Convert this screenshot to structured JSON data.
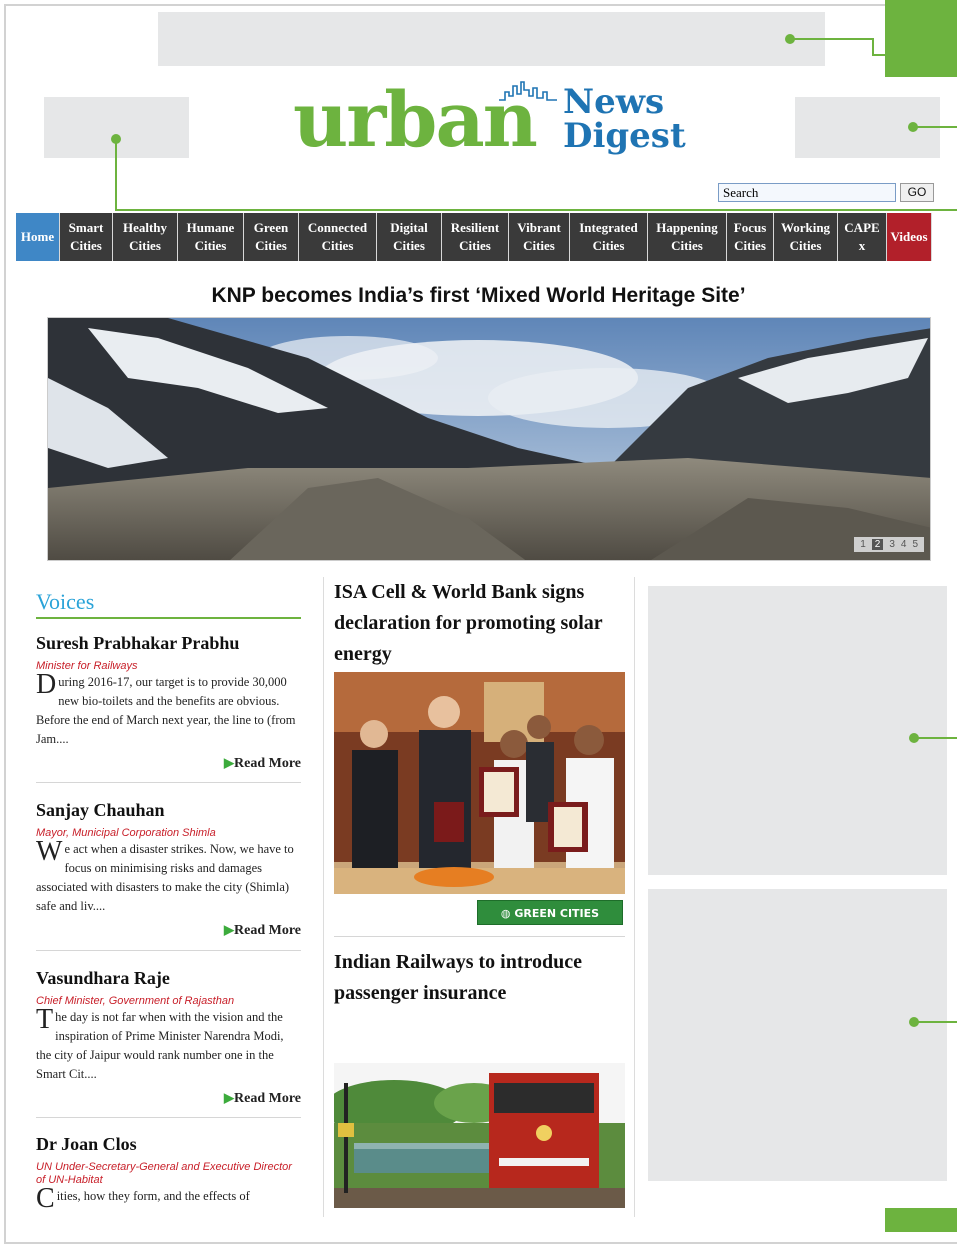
{
  "brand": {
    "word": "urban",
    "news": "News",
    "digest": "Digest"
  },
  "search": {
    "value": "Search",
    "go_label": "GO"
  },
  "nav": {
    "items": [
      {
        "line1": "Home",
        "line2": ""
      },
      {
        "line1": "Smart",
        "line2": "Cities"
      },
      {
        "line1": "Healthy",
        "line2": "Cities"
      },
      {
        "line1": "Humane",
        "line2": "Cities"
      },
      {
        "line1": "Green",
        "line2": "Cities"
      },
      {
        "line1": "Connected",
        "line2": "Cities"
      },
      {
        "line1": "Digital",
        "line2": "Cities"
      },
      {
        "line1": "Resilient",
        "line2": "Cities"
      },
      {
        "line1": "Vibrant",
        "line2": "Cities"
      },
      {
        "line1": "Integrated",
        "line2": "Cities"
      },
      {
        "line1": "Happening",
        "line2": "Cities"
      },
      {
        "line1": "Focus",
        "line2": "Cities"
      },
      {
        "line1": "Working",
        "line2": "Cities"
      },
      {
        "line1": "CAPE",
        "line2": "x"
      },
      {
        "line1": "Videos",
        "line2": ""
      }
    ]
  },
  "headline": "KNP becomes India’s first ‘Mixed World Heritage Site’",
  "slider": {
    "pages": [
      "1",
      "2",
      "3",
      "4",
      "5"
    ],
    "active": "2"
  },
  "voices": {
    "title": "Voices",
    "read_more": "Read More",
    "items": [
      {
        "name": "Suresh Prabhakar Prabhu",
        "role": "Minister for Railways",
        "cap": "D",
        "text": "uring 2016-17, our target is to provide 30,000 new bio-toilets and the benefits are obvious. Before the end of March next year, the line to (from Jam...."
      },
      {
        "name": "Sanjay Chauhan",
        "role": "Mayor, Municipal Corporation Shimla",
        "cap": "W",
        "text": "e act when a disaster strikes. Now, we have to focus on minimising risks and damages associated with disasters to make the city (Shimla) safe and liv...."
      },
      {
        "name": "Vasundhara Raje",
        "role": "Chief Minister, Government of Rajasthan",
        "cap": "T",
        "text": "he day is not far when with the vision and the inspiration of Prime Minister Narendra Modi, the city of Jaipur would rank number one in the Smart Cit...."
      },
      {
        "name": "Dr Joan Clos",
        "role": "UN Under-Secretary-General and Executive Director of UN-Habitat",
        "cap": "C",
        "text": "ities, how they form, and the effects of"
      }
    ]
  },
  "stories": [
    {
      "title": "ISA Cell & World Bank signs declaration for promoting solar energy",
      "tag": "GREEN CITIES"
    },
    {
      "title": "Indian Railways to introduce passenger insurance"
    }
  ],
  "colors": {
    "accent_green": "#6db33f",
    "brand_blue": "#1f74b3",
    "nav_dark": "#3a3a3a",
    "home_blue": "#3f87c6",
    "videos_red": "#b2202a",
    "voices_blue": "#2aa3d8"
  }
}
